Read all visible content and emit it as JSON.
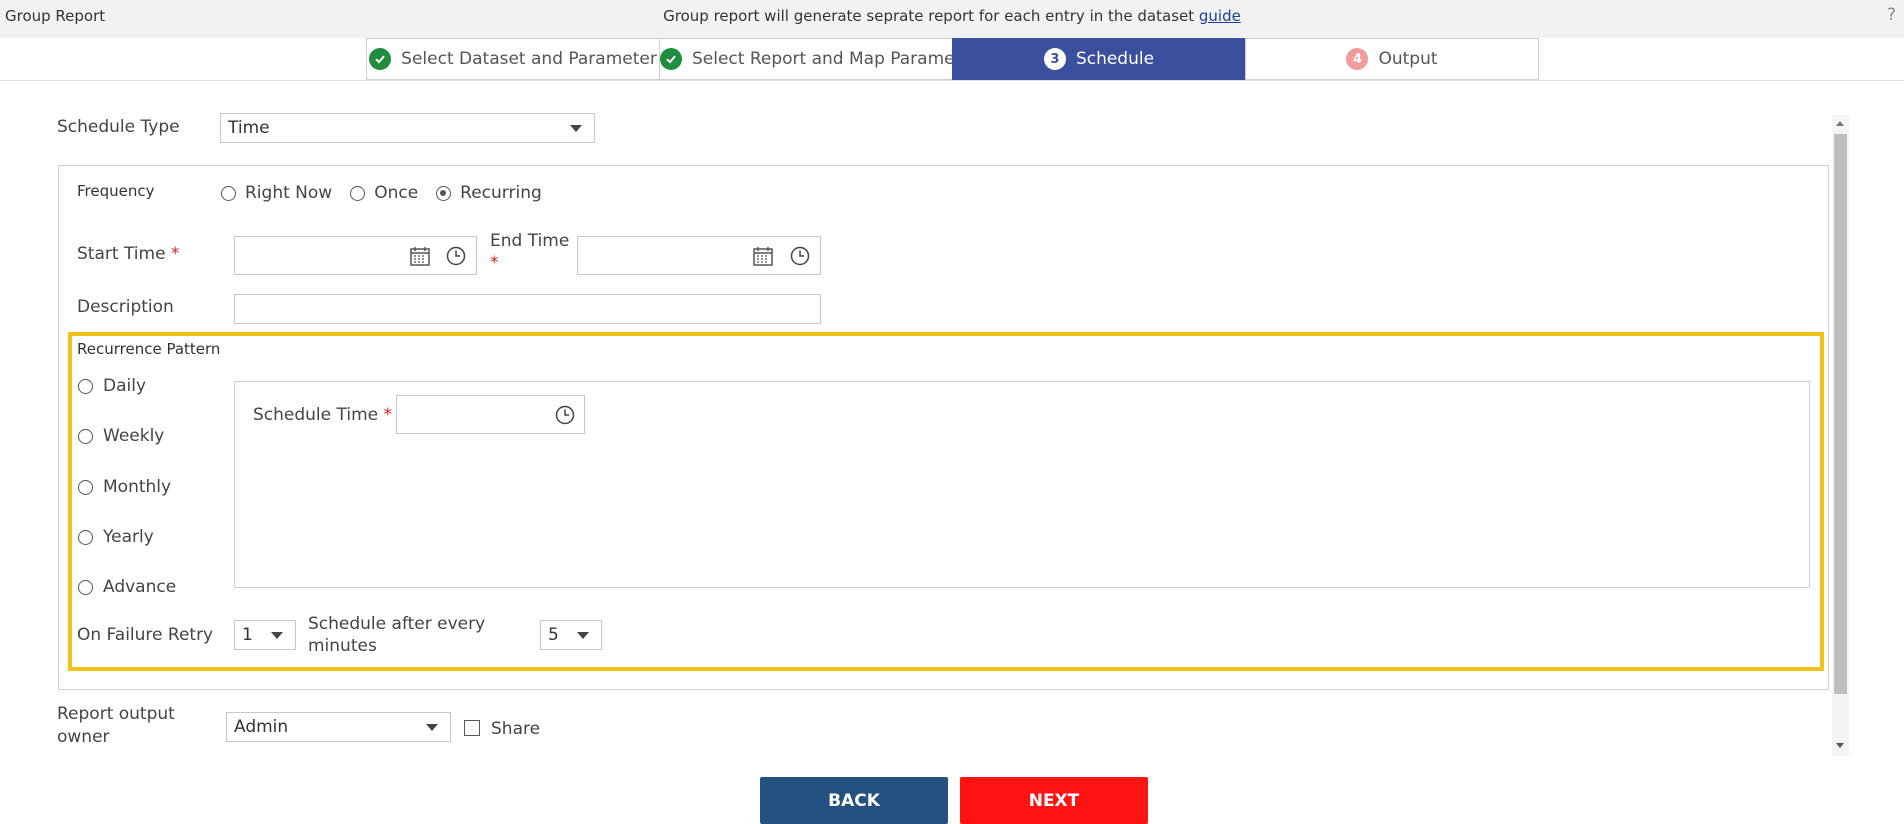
{
  "app": {
    "title": "Group Report",
    "info_text": "Group report will generate seprate report for each entry in the dataset ",
    "guide_link": "guide",
    "help_glyph": "?"
  },
  "steps": [
    {
      "number": "",
      "label": "Select Dataset and Parameter",
      "state": "done"
    },
    {
      "number": "",
      "label": "Select Report and Map Parameter",
      "state": "done"
    },
    {
      "number": "3",
      "label": "Schedule",
      "state": "active"
    },
    {
      "number": "4",
      "label": "Output",
      "state": "pending"
    }
  ],
  "schedule_type": {
    "label": "Schedule Type",
    "value": "Time"
  },
  "frequency": {
    "label": "Frequency",
    "options": [
      "Right Now",
      "Once",
      "Recurring"
    ],
    "selected": "Recurring"
  },
  "start_time": {
    "label": "Start Time",
    "required_mark": "*",
    "value": ""
  },
  "end_time": {
    "label": "End Time",
    "required_mark": "*",
    "value": ""
  },
  "description": {
    "label": "Description",
    "value": ""
  },
  "recurrence": {
    "title": "Recurrence Pattern",
    "options": [
      "Daily",
      "Weekly",
      "Monthly",
      "Yearly",
      "Advance"
    ],
    "schedule_time": {
      "label": "Schedule Time",
      "required_mark": "*",
      "value": ""
    }
  },
  "retry": {
    "label": "On Failure Retry",
    "value": "1",
    "after_label_line1": "Schedule after every",
    "after_label_line2": "minutes",
    "minutes_value": "5"
  },
  "owner": {
    "label_line1": "Report output",
    "label_line2": "owner",
    "value": "Admin",
    "share_label": "Share"
  },
  "buttons": {
    "back": "BACK",
    "next": "NEXT"
  },
  "colors": {
    "active_step": "#3a4f9e",
    "done_check": "#1e8e3e",
    "highlight_border": "#f1c21b",
    "back_button": "#235281",
    "next_button": "#ff1212",
    "required": "#d9261c"
  },
  "icons": {
    "done": "check-circle-icon",
    "calendar": "calendar-icon",
    "clock": "clock-icon",
    "dropdown": "caret-down-icon"
  }
}
